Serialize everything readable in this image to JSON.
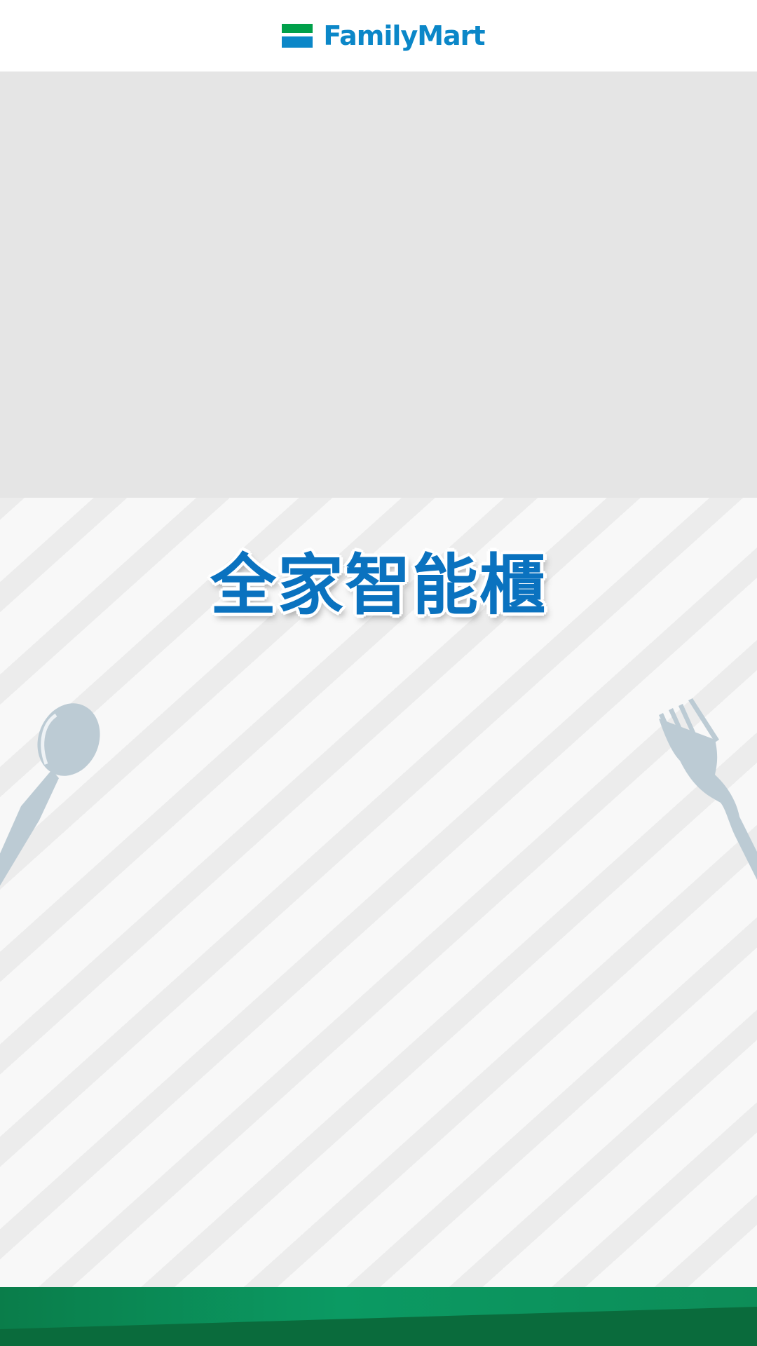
{
  "header": {
    "brand_name": "FamilyMart",
    "brand_icon": "familymart-stripes-logo-icon"
  },
  "banner": {
    "type": "image-placeholder"
  },
  "main": {
    "title": "全家智能櫃",
    "decorations": [
      "spoon-icon",
      "fork-icon"
    ]
  },
  "colors": {
    "brand_blue": "#0b87c8",
    "brand_green": "#00a04a",
    "title_blue": "#0a72bf",
    "footer_green": "#0f7a49",
    "utensil_grey": "#bccbd4"
  }
}
